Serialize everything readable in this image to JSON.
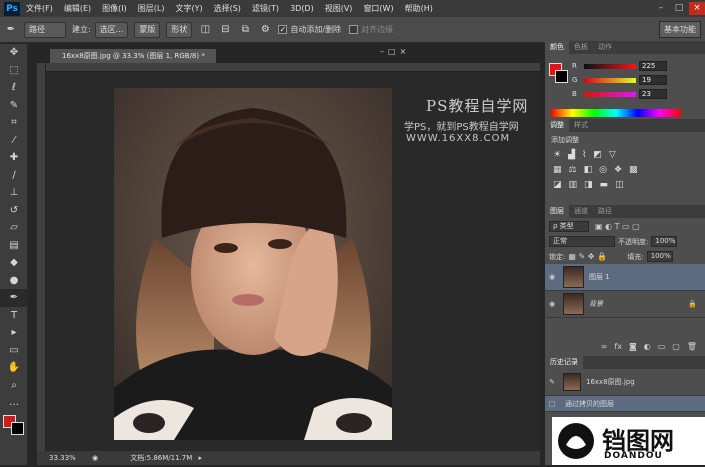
{
  "menubar": {
    "logo": "Ps",
    "items": [
      "文件(F)",
      "编辑(E)",
      "图像(I)",
      "图层(L)",
      "文字(Y)",
      "选择(S)",
      "滤镜(T)",
      "3D(D)",
      "视图(V)",
      "窗口(W)",
      "帮助(H)"
    ],
    "minimize": "–",
    "restore": "□",
    "close": "×"
  },
  "options": {
    "path_mode": "路径",
    "build_label": "建立:",
    "selection_btn": "选区...",
    "mask_btn": "蒙版",
    "shape_btn": "形状",
    "auto_add_delete": "自动添加/删除",
    "align_edges": "对齐边缘",
    "workspace": "基本功能"
  },
  "document": {
    "tab_title": "16xx8原图.jpg @ 33.3% (图层 1, RGB/8) *",
    "zoom": "33.33%",
    "doc_size": "文档:5.86M/11.7M"
  },
  "watermark": {
    "line1": "PS教程自学网",
    "line2": "学PS，就到PS教程自学网",
    "line3": "WWW.16XX8.COM"
  },
  "color_panel": {
    "tabs": [
      "颜色",
      "色板",
      "动作"
    ],
    "channels": [
      {
        "label": "R",
        "value": "225"
      },
      {
        "label": "G",
        "value": "19"
      },
      {
        "label": "B",
        "value": "23"
      }
    ],
    "foreground": "#e11317"
  },
  "adjust_panel": {
    "tabs": [
      "调整",
      "样式"
    ],
    "title": "添加调整"
  },
  "layers_panel": {
    "tabs": [
      "图层",
      "通道",
      "路径"
    ],
    "kind_filter": "ρ 类型",
    "blend_mode": "正常",
    "opacity_label": "不透明度:",
    "opacity": "100%",
    "lock_label": "锁定:",
    "fill_label": "填充:",
    "fill": "100%",
    "layers": [
      {
        "name": "图层 1",
        "selected": true,
        "locked": false
      },
      {
        "name": "背景",
        "selected": false,
        "locked": true
      }
    ]
  },
  "history_panel": {
    "tab": "历史记录",
    "snapshot": "16xx8原图.jpg",
    "steps": [
      "通过拷贝的图层"
    ]
  },
  "site_logo": {
    "name": "铛图网",
    "domain": "DOANDOU"
  }
}
